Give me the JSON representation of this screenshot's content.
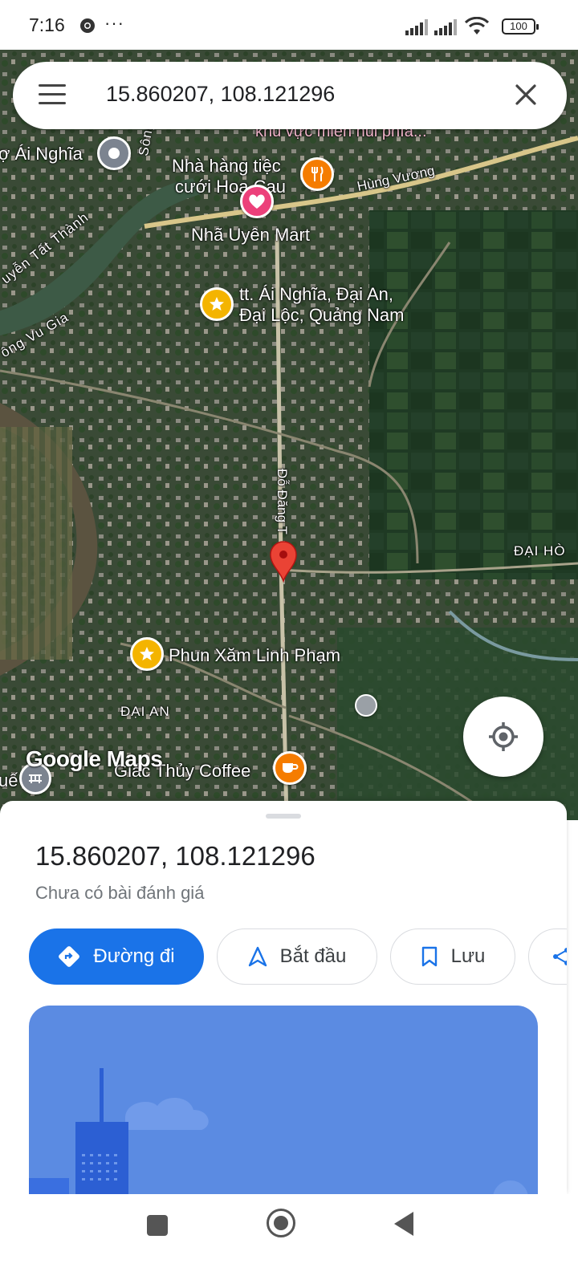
{
  "status_bar": {
    "time": "7:16",
    "more": "···",
    "battery": "100"
  },
  "search": {
    "query": "15.860207, 108.121296"
  },
  "map": {
    "labels": {
      "ai_nghia_market": "ợ Ái Nghĩa",
      "song_yen": "Sông Yên",
      "nguyen_tat_thanh": "uyễn Tất Thành",
      "song_vu_gia": "ông Vu Gia",
      "restaurant_line1": "Nhà hàng tiệc",
      "restaurant_line2": "cưới Hoa Cau",
      "hung_vuong": "Hùng Vương",
      "top_partial": "khu vực miền núi phía...",
      "mart": "Nhã Uyên Mart",
      "town_line1": "tt. Ái Nghĩa, Đại An,",
      "town_line2": "Đại Lộc, Quảng Nam",
      "do_dang_tuyen": "Đỗ Đăng T",
      "dai_hoa": "ĐẠI HÒ",
      "phun_xam": "Phun Xăm Linh Phạm",
      "dai_an": "ĐẠI AN",
      "coffee": "Giác Thủy Coffee",
      "hue_partial": "uế"
    },
    "watermark": "Google Maps"
  },
  "place": {
    "title": "15.860207, 108.121296",
    "subtitle": "Chưa có bài đánh giá"
  },
  "actions": {
    "directions": "Đường đi",
    "start": "Bắt đầu",
    "save": "Lưu"
  },
  "colors": {
    "accent": "#1a73e8",
    "pin": "#ea4335",
    "illustration": "#5b8be2"
  }
}
